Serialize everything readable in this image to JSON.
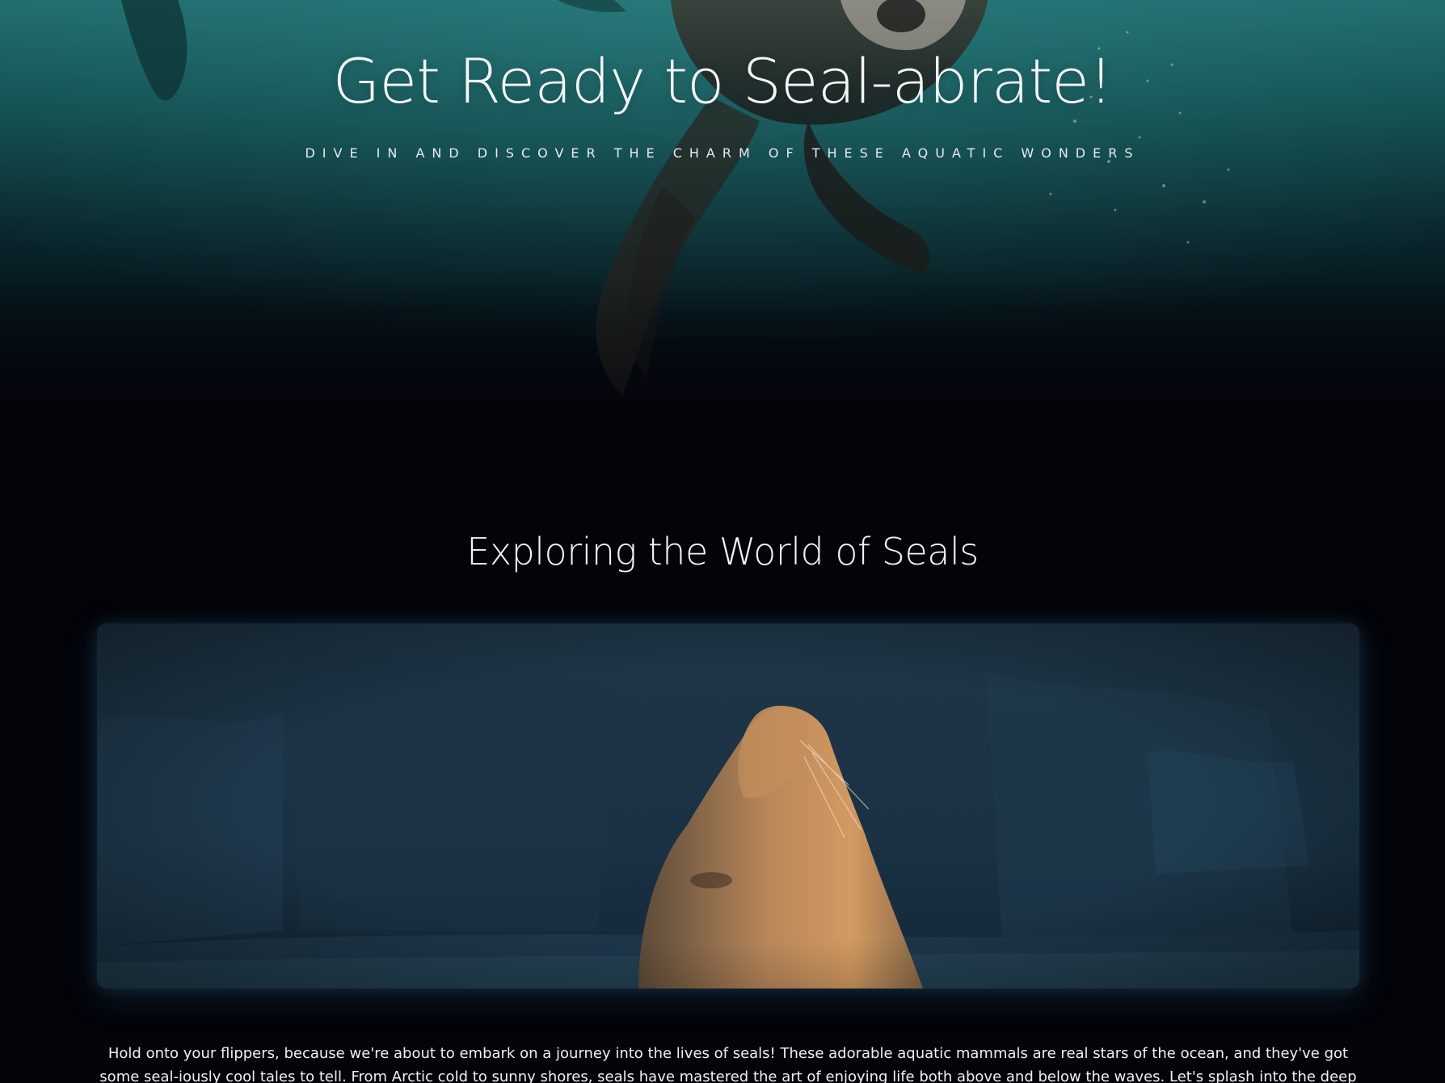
{
  "hero": {
    "title": "Get Ready to Seal-abrate!",
    "subtitle": "DIVE IN AND DISCOVER THE CHARM OF THESE AQUATIC WONDERS",
    "background_color": "#1f6a6b"
  },
  "section": {
    "title": "Exploring the World of Seals",
    "intro": "Hold onto your flippers, because we're about to embark on a journey into the lives of seals! These adorable aquatic mammals are real stars of the ocean, and they've got some seal-iously cool tales to tell. From Arctic cold to sunny shores, seals have mastered the art of enjoying life both above and below the waves. Let's splash into the deep waters of seal"
  },
  "colors": {
    "page_background": "#03040a",
    "text": "#f1f3f5"
  }
}
